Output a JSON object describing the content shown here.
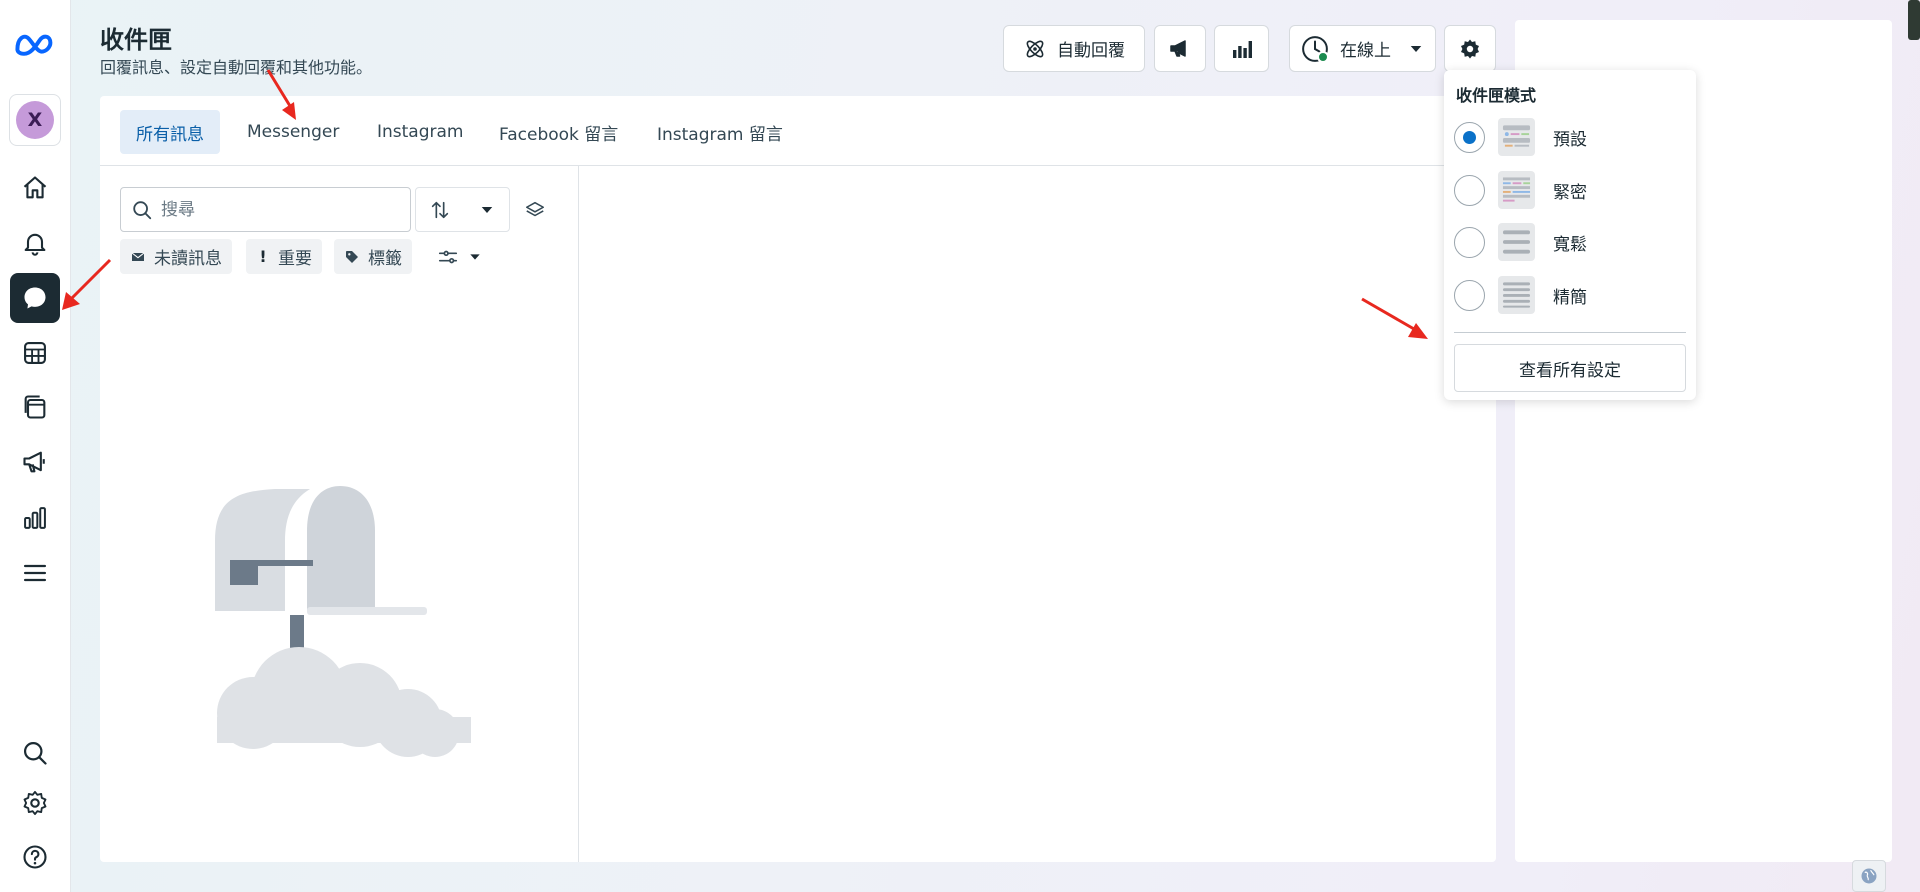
{
  "header": {
    "title": "收件匣",
    "subtitle": "回覆訊息、設定自動回覆和其他功能。",
    "auto_reply_label": "自動回覆",
    "status_label": "在線上"
  },
  "tabs": [
    {
      "label": "所有訊息",
      "active": true
    },
    {
      "label": "Messenger",
      "active": false
    },
    {
      "label": "Instagram",
      "active": false
    },
    {
      "label": "Facebook 留言",
      "active": false
    },
    {
      "label": "Instagram 留言",
      "active": false
    }
  ],
  "search": {
    "placeholder": "搜尋",
    "value": ""
  },
  "filters": {
    "unread_label": "未讀訊息",
    "important_label": "重要",
    "tags_label": "標籤"
  },
  "avatar": {
    "initial": "X",
    "color": "#c59ad9"
  },
  "sidebar": {
    "items": [
      {
        "icon": "home-icon"
      },
      {
        "icon": "bell-icon"
      },
      {
        "icon": "chat-icon",
        "active": true
      },
      {
        "icon": "table-icon"
      },
      {
        "icon": "pages-icon"
      },
      {
        "icon": "megaphone-icon"
      },
      {
        "icon": "bar-chart-icon"
      },
      {
        "icon": "menu-icon"
      },
      {
        "icon": "search-icon"
      },
      {
        "icon": "gear-icon"
      },
      {
        "icon": "help-icon"
      }
    ]
  },
  "inbox_mode_menu": {
    "title": "收件匣模式",
    "options": [
      {
        "label": "預設",
        "selected": true
      },
      {
        "label": "緊密",
        "selected": false
      },
      {
        "label": "寬鬆",
        "selected": false
      },
      {
        "label": "精簡",
        "selected": false
      }
    ],
    "all_settings_label": "查看所有設定"
  },
  "colors": {
    "accent": "#0a71c8",
    "active_tab_bg": "#e3edf8",
    "rail_active_bg": "#1c2b33",
    "online": "#1b8a4e",
    "annotation_arrow": "#e8281f"
  }
}
